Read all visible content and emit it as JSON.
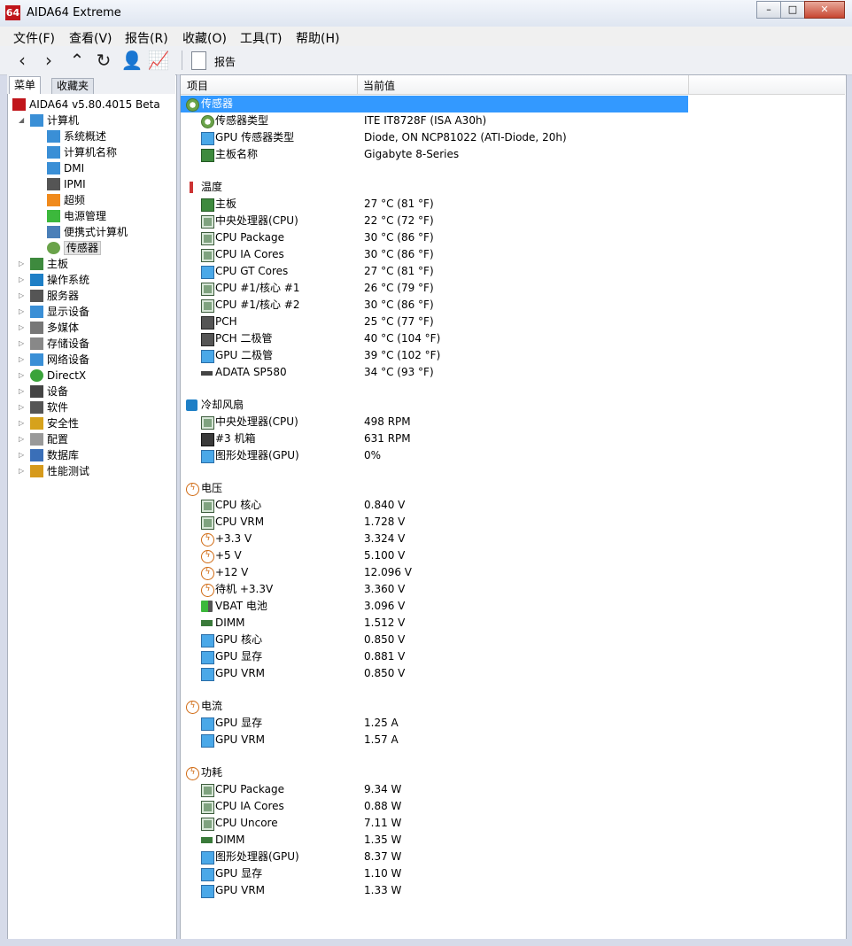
{
  "window": {
    "title": "AIDA64 Extreme",
    "logo": "64",
    "minimize": "–",
    "maximize": "□",
    "close": "✕"
  },
  "menu": [
    "文件(F)",
    "查看(V)",
    "报告(R)",
    "收藏(O)",
    "工具(T)",
    "帮助(H)"
  ],
  "toolbar": {
    "report_label": "报告"
  },
  "tabs": {
    "menu": "菜单",
    "favorites": "收藏夹"
  },
  "tree": [
    {
      "label": "AIDA64 v5.80.4015 Beta",
      "icon": "aida64-logo-icon",
      "x": 6,
      "level": 0
    },
    {
      "label": "计算机",
      "icon": "computer-icon",
      "x": 26,
      "level": 1,
      "expander": "◢"
    },
    {
      "label": "系统概述",
      "icon": "monitor-icon",
      "x": 45,
      "level": 2
    },
    {
      "label": "计算机名称",
      "icon": "monitor-icon",
      "x": 45,
      "level": 2
    },
    {
      "label": "DMI",
      "icon": "monitor-icon",
      "x": 45,
      "level": 2
    },
    {
      "label": "IPMI",
      "icon": "server-icon",
      "x": 45,
      "level": 2
    },
    {
      "label": "超频",
      "icon": "flame-icon",
      "x": 45,
      "level": 2
    },
    {
      "label": "电源管理",
      "icon": "battery-icon",
      "x": 45,
      "level": 2
    },
    {
      "label": "便携式计算机",
      "icon": "laptop-icon",
      "x": 45,
      "level": 2
    },
    {
      "label": "传感器",
      "icon": "gauge-icon",
      "x": 45,
      "level": 2,
      "selected": true
    },
    {
      "label": "主板",
      "icon": "motherboard-icon",
      "x": 26,
      "level": 1,
      "expander": "▷"
    },
    {
      "label": "操作系统",
      "icon": "windows-icon",
      "x": 26,
      "level": 1,
      "expander": "▷"
    },
    {
      "label": "服务器",
      "icon": "server-icon",
      "x": 26,
      "level": 1,
      "expander": "▷"
    },
    {
      "label": "显示设备",
      "icon": "monitor-icon",
      "x": 26,
      "level": 1,
      "expander": "▷"
    },
    {
      "label": "多媒体",
      "icon": "speaker-icon",
      "x": 26,
      "level": 1,
      "expander": "▷"
    },
    {
      "label": "存储设备",
      "icon": "storage-icon",
      "x": 26,
      "level": 1,
      "expander": "▷"
    },
    {
      "label": "网络设备",
      "icon": "network-icon",
      "x": 26,
      "level": 1,
      "expander": "▷"
    },
    {
      "label": "DirectX",
      "icon": "directx-icon",
      "x": 26,
      "level": 1,
      "expander": "▷"
    },
    {
      "label": "设备",
      "icon": "device-icon",
      "x": 26,
      "level": 1,
      "expander": "▷"
    },
    {
      "label": "软件",
      "icon": "software-icon",
      "x": 26,
      "level": 1,
      "expander": "▷"
    },
    {
      "label": "安全性",
      "icon": "shield-icon",
      "x": 26,
      "level": 1,
      "expander": "▷"
    },
    {
      "label": "配置",
      "icon": "config-icon",
      "x": 26,
      "level": 1,
      "expander": "▷"
    },
    {
      "label": "数据库",
      "icon": "database-icon",
      "x": 26,
      "level": 1,
      "expander": "▷"
    },
    {
      "label": "性能测试",
      "icon": "benchmark-icon",
      "x": 26,
      "level": 1,
      "expander": "▷"
    }
  ],
  "columns": {
    "item": "项目",
    "value": "当前值"
  },
  "rows": [
    {
      "type": "section",
      "label": "传感器",
      "icon": "gauge",
      "highlight": true
    },
    {
      "label": "传感器类型",
      "value": "ITE IT8728F  (ISA A30h)",
      "icon": "gauge"
    },
    {
      "label": "GPU 传感器类型",
      "value": "Diode, ON NCP81022  (ATI-Diode, 20h)",
      "icon": "monitor"
    },
    {
      "label": "主板名称",
      "value": "Gigabyte 8-Series",
      "icon": "board"
    },
    {
      "type": "gap"
    },
    {
      "type": "section",
      "label": "温度",
      "icon": "therm"
    },
    {
      "label": "主板",
      "value": "27 °C  (81 °F)",
      "icon": "board"
    },
    {
      "label": "中央处理器(CPU)",
      "value": "22 °C  (72 °F)",
      "icon": "chip"
    },
    {
      "label": "CPU Package",
      "value": "30 °C  (86 °F)",
      "icon": "chip"
    },
    {
      "label": "CPU IA Cores",
      "value": "30 °C  (86 °F)",
      "icon": "chip"
    },
    {
      "label": "CPU GT Cores",
      "value": "27 °C  (81 °F)",
      "icon": "monitor"
    },
    {
      "label": "CPU #1/核心 #1",
      "value": "26 °C  (79 °F)",
      "icon": "chip"
    },
    {
      "label": "CPU #1/核心 #2",
      "value": "30 °C  (86 °F)",
      "icon": "chip"
    },
    {
      "label": "PCH",
      "value": "25 °C  (77 °F)",
      "icon": "pch"
    },
    {
      "label": "PCH 二极管",
      "value": "40 °C  (104 °F)",
      "icon": "pch"
    },
    {
      "label": "GPU 二极管",
      "value": "39 °C  (102 °F)",
      "icon": "monitor"
    },
    {
      "label": "ADATA SP580",
      "value": "34 °C  (93 °F)",
      "icon": "drive"
    },
    {
      "type": "gap"
    },
    {
      "type": "section",
      "label": "冷却风扇",
      "icon": "fan"
    },
    {
      "label": "中央处理器(CPU)",
      "value": "498 RPM",
      "icon": "chip"
    },
    {
      "label": "#3 机箱",
      "value": "631 RPM",
      "icon": "chassis"
    },
    {
      "label": "图形处理器(GPU)",
      "value": "0%",
      "icon": "monitor"
    },
    {
      "type": "gap"
    },
    {
      "type": "section",
      "label": "电压",
      "icon": "bolt"
    },
    {
      "label": "CPU 核心",
      "value": "0.840 V",
      "icon": "chip"
    },
    {
      "label": "CPU VRM",
      "value": "1.728 V",
      "icon": "chip"
    },
    {
      "label": "+3.3 V",
      "value": "3.324 V",
      "icon": "bolt"
    },
    {
      "label": "+5 V",
      "value": "5.100 V",
      "icon": "bolt"
    },
    {
      "label": "+12 V",
      "value": "12.096 V",
      "icon": "bolt"
    },
    {
      "label": "待机 +3.3V",
      "value": "3.360 V",
      "icon": "bolt"
    },
    {
      "label": "VBAT 电池",
      "value": "3.096 V",
      "icon": "battery"
    },
    {
      "label": "DIMM",
      "value": "1.512 V",
      "icon": "dimm"
    },
    {
      "label": "GPU 核心",
      "value": "0.850 V",
      "icon": "monitor"
    },
    {
      "label": "GPU 显存",
      "value": "0.881 V",
      "icon": "monitor"
    },
    {
      "label": "GPU VRM",
      "value": "0.850 V",
      "icon": "monitor"
    },
    {
      "type": "gap"
    },
    {
      "type": "section",
      "label": "电流",
      "icon": "bolt"
    },
    {
      "label": "GPU 显存",
      "value": "1.25 A",
      "icon": "monitor"
    },
    {
      "label": "GPU VRM",
      "value": "1.57 A",
      "icon": "monitor"
    },
    {
      "type": "gap"
    },
    {
      "type": "section",
      "label": "功耗",
      "icon": "bolt"
    },
    {
      "label": "CPU Package",
      "value": "9.34 W",
      "icon": "chip"
    },
    {
      "label": "CPU IA Cores",
      "value": "0.88 W",
      "icon": "chip"
    },
    {
      "label": "CPU Uncore",
      "value": "7.11 W",
      "icon": "chip"
    },
    {
      "label": "DIMM",
      "value": "1.35 W",
      "icon": "dimm"
    },
    {
      "label": "图形处理器(GPU)",
      "value": "8.37 W",
      "icon": "monitor"
    },
    {
      "label": "GPU 显存",
      "value": "1.10 W",
      "icon": "monitor"
    },
    {
      "label": "GPU VRM",
      "value": "1.33 W",
      "icon": "monitor"
    }
  ]
}
